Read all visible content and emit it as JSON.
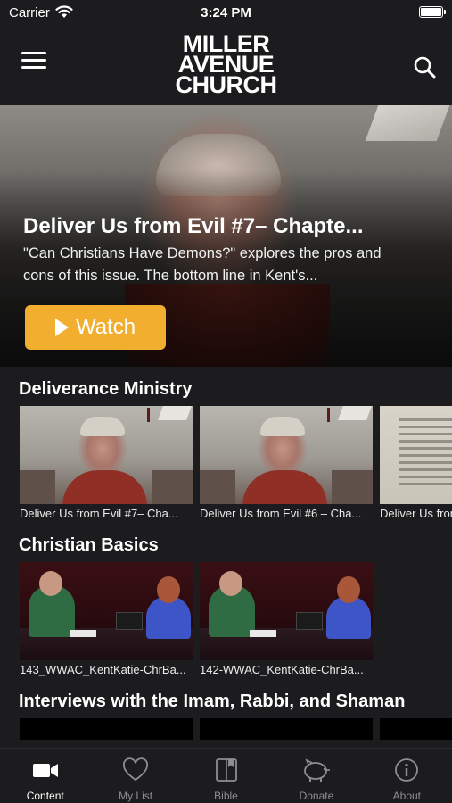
{
  "status_bar": {
    "carrier": "Carrier",
    "time": "3:24 PM",
    "wifi_icon": "wifi-icon",
    "battery_icon": "battery-icon"
  },
  "header": {
    "logo_lines": [
      "MILLER",
      "AVENUE",
      "CHURCH"
    ],
    "menu_icon": "hamburger-menu-icon",
    "search_icon": "search-icon"
  },
  "hero": {
    "title": "Deliver Us from Evil #7– Chapte...",
    "description": "\"Can Christians Have Demons?\" explores the pros and cons of this issue. The bottom line in Kent's...",
    "watch_label": "Watch",
    "accent": "#f2ae2f"
  },
  "sections": [
    {
      "title": "Deliverance Ministry",
      "items": [
        {
          "label": "Deliver Us from Evil #7– Cha..."
        },
        {
          "label": "Deliver Us from Evil #6 – Cha..."
        },
        {
          "label": "Deliver Us from Evil..."
        }
      ]
    },
    {
      "title": "Christian Basics",
      "items": [
        {
          "label": "143_WWAC_KentKatie-ChrBa..."
        },
        {
          "label": "142-WWAC_KentKatie-ChrBa..."
        }
      ]
    },
    {
      "title": "Interviews with the Imam, Rabbi, and Shaman",
      "items": []
    }
  ],
  "tabbar": {
    "tabs": [
      {
        "label": "Content",
        "icon": "video-camera-icon",
        "active": true
      },
      {
        "label": "My List",
        "icon": "heart-icon",
        "active": false
      },
      {
        "label": "Bible",
        "icon": "book-icon",
        "active": false
      },
      {
        "label": "Donate",
        "icon": "piggy-bank-icon",
        "active": false
      },
      {
        "label": "About",
        "icon": "info-icon",
        "active": false
      }
    ]
  }
}
